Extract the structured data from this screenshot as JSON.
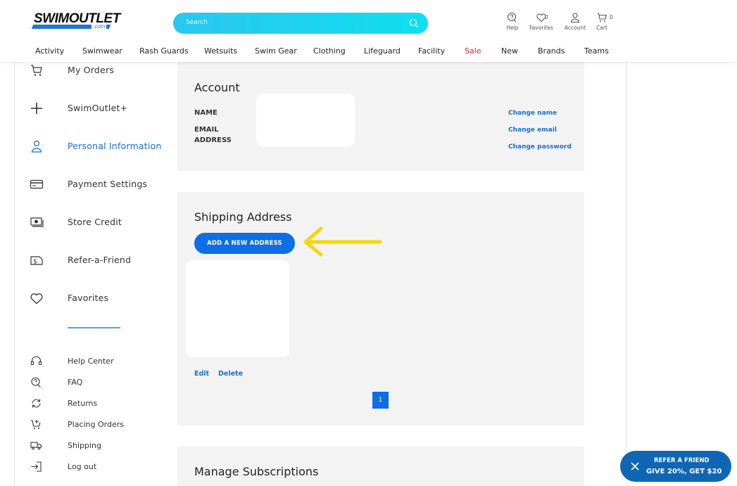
{
  "brand": {
    "logo_text": "SWIMOUTLET",
    "logo_sub": ".com",
    "accent": "#0d6ee6",
    "sale_color": "#d9262b"
  },
  "search": {
    "placeholder": "Search"
  },
  "utility": {
    "help": "Help",
    "favorites": "Favorites",
    "favorites_count": "0",
    "account": "Account",
    "cart": "Cart",
    "cart_count": "0"
  },
  "nav": [
    "Activity",
    "Swimwear",
    "Rash Guards",
    "Wetsuits",
    "Swim Gear",
    "Clothing",
    "Lifeguard",
    "Facility",
    "Sale",
    "New",
    "Brands",
    "Teams"
  ],
  "sidebar": {
    "items": [
      {
        "label": "My Orders",
        "icon": "cart-icon"
      },
      {
        "label": "SwimOutlet+",
        "icon": "plus-icon"
      },
      {
        "label": "Personal Information",
        "icon": "person-icon",
        "active": true
      },
      {
        "label": "Payment Settings",
        "icon": "credit-card-icon"
      },
      {
        "label": "Store Credit",
        "icon": "money-icon"
      },
      {
        "label": "Refer-a-Friend",
        "icon": "dollar-doc-icon"
      },
      {
        "label": "Favorites",
        "icon": "heart-icon"
      }
    ],
    "help_items": [
      {
        "label": "Help Center",
        "icon": "headset-icon"
      },
      {
        "label": "FAQ",
        "icon": "faq-icon"
      },
      {
        "label": "Returns",
        "icon": "refresh-icon"
      },
      {
        "label": "Placing Orders",
        "icon": "cart-plus-icon"
      },
      {
        "label": "Shipping",
        "icon": "truck-icon"
      },
      {
        "label": "Log out",
        "icon": "logout-icon"
      }
    ]
  },
  "account": {
    "title": "Account",
    "name_label": "NAME",
    "email_label_1": "EMAIL",
    "email_label_2": "ADDRESS",
    "change_name": "Change name",
    "change_email": "Change email",
    "change_password": "Change password"
  },
  "shipping": {
    "title": "Shipping Address",
    "add_button": "ADD A NEW ADDRESS",
    "edit": "Edit",
    "delete": "Delete",
    "page": "1"
  },
  "subscriptions": {
    "title": "Manage Subscriptions"
  },
  "refer_banner": {
    "line1": "REFER A FRIEND",
    "line2": "GIVE 20%, GET $20"
  }
}
